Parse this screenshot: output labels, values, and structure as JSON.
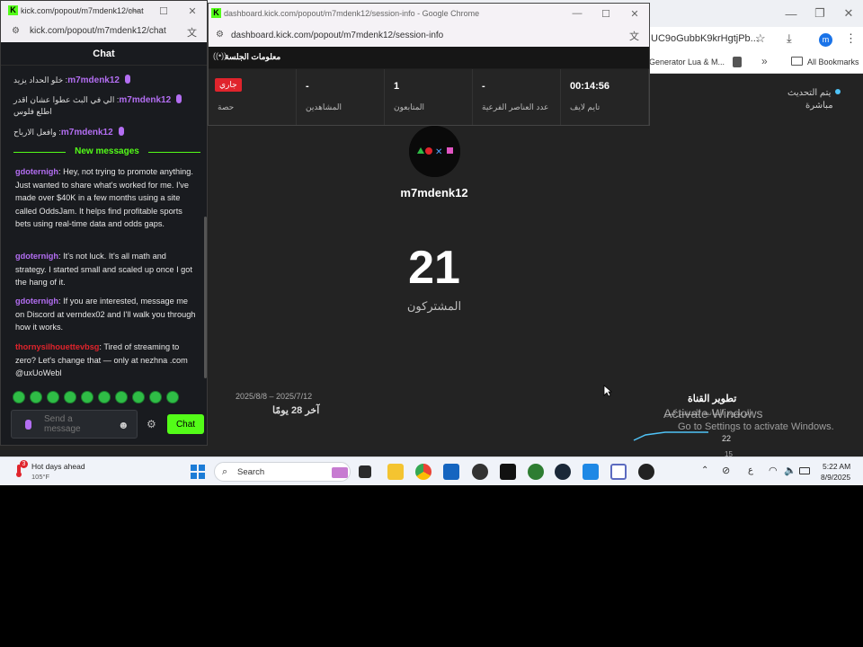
{
  "background_browser": {
    "url": "UC9oGubbK9krHgtjPb...",
    "avatar_letter": "m",
    "bookmark_1": "Generator Lua & M...",
    "all_bookmarks": "All Bookmarks"
  },
  "dashboard": {
    "update_status": "يتم التحديث",
    "update_status_sub": "مباشرة",
    "channel_name": "m7mdenk12",
    "subscriber_count": "21",
    "subscriber_label": "المشتركون",
    "date_range": "2025/8/8 – 2025/7/12",
    "date_period": "آخر 28 يومًا",
    "growth_title": "تطوير القناة",
    "growth_subtitle": "الرسوم البيانية للمشتركين",
    "chart_tick_22": "22",
    "chart_tick_15": "15",
    "activate_windows_title": "Activate Windows",
    "activate_windows_sub": "Go to Settings to activate Windows."
  },
  "session_window": {
    "title": "dashboard.kick.com/popout/m7mdenk12/session-info - Google Chrome",
    "url": "dashboard.kick.com/popout/m7mdenk12/session-info",
    "header_title": "معلومات الجلسة",
    "stats": [
      {
        "value": "جاري",
        "label": "حصة"
      },
      {
        "value": "-",
        "label": "المشاهدين"
      },
      {
        "value": "1",
        "label": "المتابعون"
      },
      {
        "value": "-",
        "label": "عدد العناصر الفرعية"
      },
      {
        "value": "00:14:56",
        "label": "تايم لايف"
      }
    ],
    "badge_color": "#e0242c"
  },
  "chat_window": {
    "title": "kick.com/popout/m7mdenk12/chat",
    "url": "kick.com/popout/m7mdenk12/chat",
    "header": "Chat",
    "old_messages": [
      {
        "user": "m7mdenk12",
        "text": ": خلو الحداد يزيد"
      },
      {
        "user": "m7mdenk12",
        "text": ": الي في البث عطوا عشان اقدر اطلع فلوس"
      },
      {
        "user": "m7mdenk12",
        "text": ": وافعل الارباح"
      }
    ],
    "new_messages_label": "New messages",
    "messages": [
      {
        "user": "gdoternigh",
        "text": ": Hey, not trying to promote anything. Just wanted to share what's worked for me. I've made over $40K in a few months using a site called OddsJam. It helps find profitable sports bets using real-time data and odds gaps."
      },
      {
        "user": "gdoternigh",
        "text": ": It's not luck. It's all math and strategy. I started small and scaled up once I got the hang of it."
      },
      {
        "user": "gdoternigh",
        "text": ": If you are interested, message me on Discord at verndex02 and I'll walk you through how it works."
      },
      {
        "user": "thornysilhouettevbsg",
        "text": ": Tired of streaming to zero? Let's change that — only at nezhna .com @uxUoWebl"
      }
    ],
    "user_colors": {
      "gdoternigh": "#b36ef2",
      "thornysilhouettevbsg": "#e0242c"
    },
    "input_placeholder": "Send a message",
    "send_label": "Chat",
    "accent_color": "#53fc18"
  },
  "taskbar": {
    "weather_badge": "3",
    "weather_title": "Hot days ahead",
    "weather_temp": "105°F",
    "search_text": "Search",
    "tray_lang": "ع",
    "clock_time": "5:22 AM",
    "clock_date": "8/9/2025"
  }
}
